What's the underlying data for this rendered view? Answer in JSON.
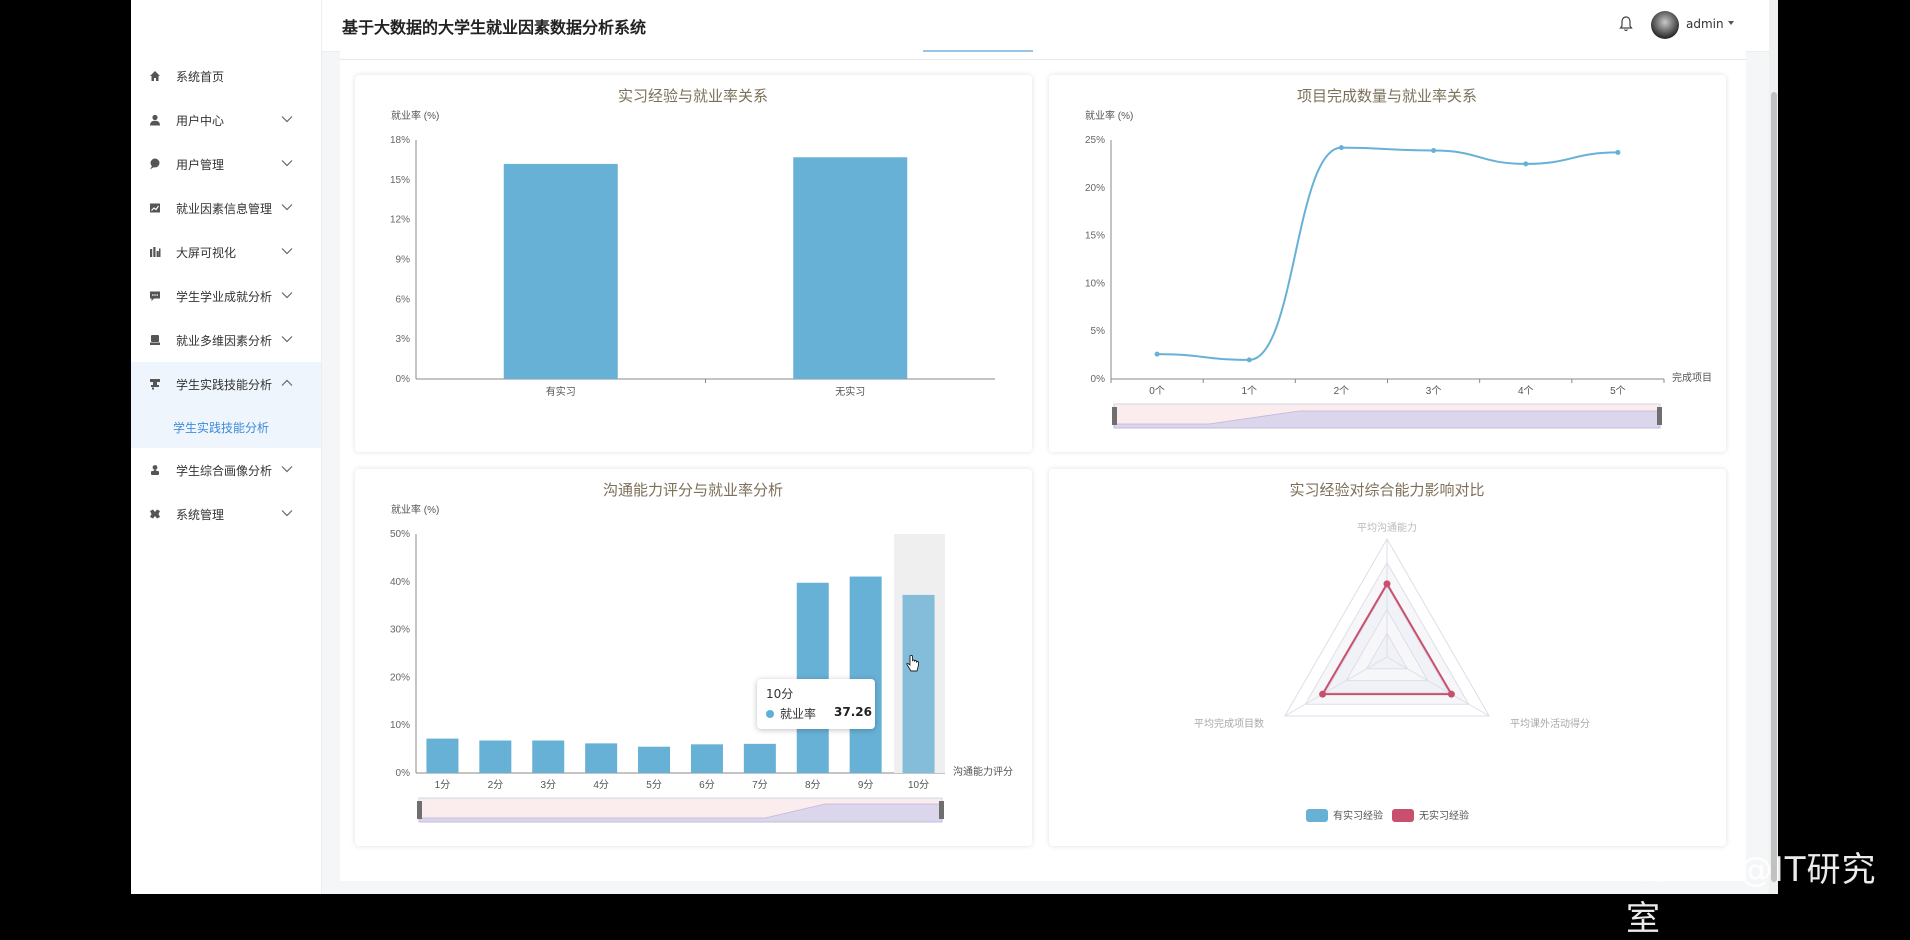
{
  "header": {
    "title": "基于大数据的大学生就业因素数据分析系统",
    "username": "admin"
  },
  "sidebar": {
    "items": [
      {
        "label": "系统首页",
        "icon": "home-icon",
        "expandable": false
      },
      {
        "label": "用户中心",
        "icon": "user-icon",
        "expandable": true
      },
      {
        "label": "用户管理",
        "icon": "pin-icon",
        "expandable": true
      },
      {
        "label": "就业因素信息管理",
        "icon": "chart-board-icon",
        "expandable": true
      },
      {
        "label": "大屏可视化",
        "icon": "bar-icon",
        "expandable": true
      },
      {
        "label": "学生学业成就分析",
        "icon": "message-icon",
        "expandable": true
      },
      {
        "label": "就业多维因素分析",
        "icon": "printer-icon",
        "expandable": true
      },
      {
        "label": "学生实践技能分析",
        "icon": "stamp-icon",
        "expandable": true,
        "open": true
      },
      {
        "label": "学生综合画像分析",
        "icon": "person-icon",
        "expandable": true
      },
      {
        "label": "系统管理",
        "icon": "ticket-icon",
        "expandable": true
      }
    ],
    "subitem": {
      "label": "学生实践技能分析"
    }
  },
  "tooltip": {
    "title": "10分",
    "series": "就业率",
    "value": "37.26"
  },
  "watermark": "CSDN @IT研究室",
  "colors": {
    "primary": "#5fb0d7",
    "pink": "#c8506e",
    "accent": "#3d8cd8"
  },
  "chart_data": [
    {
      "type": "bar",
      "title": "实习经验与就业率关系",
      "ylabel": "就业率 (%)",
      "categories": [
        "有实习",
        "无实习"
      ],
      "values": [
        16.2,
        16.7
      ],
      "ylim": [
        0,
        18
      ],
      "yticks": [
        "0%",
        "3%",
        "6%",
        "9%",
        "12%",
        "15%",
        "18%"
      ]
    },
    {
      "type": "line",
      "title": "项目完成数量与就业率关系",
      "ylabel": "就业率 (%)",
      "xlabel": "完成项目",
      "categories": [
        "0个",
        "1个",
        "2个",
        "3个",
        "4个",
        "5个"
      ],
      "values": [
        2.6,
        2.0,
        24.2,
        23.9,
        22.5,
        23.7
      ],
      "ylim": [
        0,
        25
      ],
      "yticks": [
        "0%",
        "5%",
        "10%",
        "15%",
        "20%",
        "25%"
      ]
    },
    {
      "type": "bar",
      "title": "沟通能力评分与就业率分析",
      "ylabel": "就业率 (%)",
      "xlabel": "沟通能力评分",
      "categories": [
        "1分",
        "2分",
        "3分",
        "4分",
        "5分",
        "6分",
        "7分",
        "8分",
        "9分",
        "10分"
      ],
      "values": [
        7.2,
        6.8,
        6.8,
        6.2,
        5.5,
        6.0,
        6.1,
        39.8,
        41.1,
        37.26
      ],
      "ylim": [
        0,
        50
      ],
      "yticks": [
        "0%",
        "10%",
        "20%",
        "30%",
        "40%",
        "50%"
      ]
    },
    {
      "type": "radar",
      "title": "实习经验对综合能力影响对比",
      "indicators": [
        "平均沟通能力",
        "平均课外活动得分",
        "平均完成项目数"
      ],
      "legend": [
        "有实习经验",
        "无实习经验"
      ]
    }
  ]
}
